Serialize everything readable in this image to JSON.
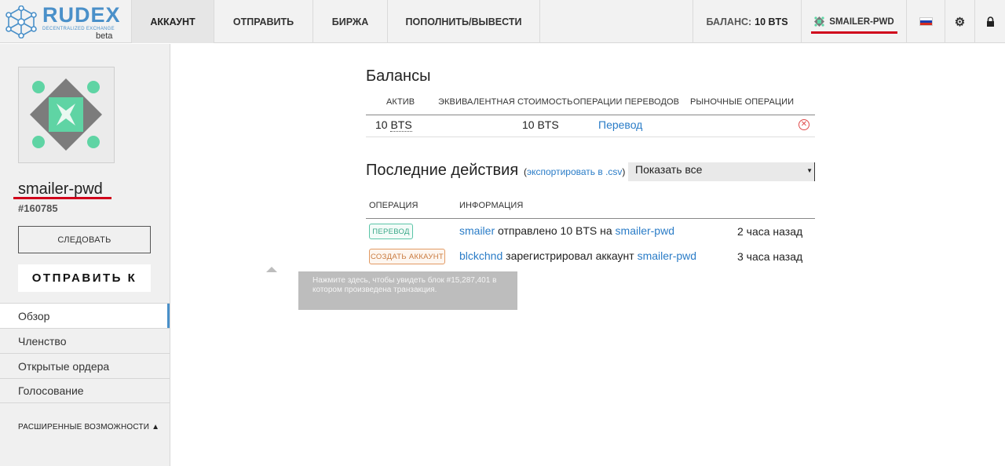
{
  "header": {
    "logo_name": "RUDEX",
    "logo_sub": "DECENTRALIZED EXCHANGE",
    "logo_beta": "beta",
    "nav": {
      "account": "АККАУНТ",
      "send": "ОТПРАВИТЬ",
      "exchange": "БИРЖА",
      "deposit": "ПОПОЛНИТЬ/ВЫВЕСТИ"
    },
    "balance_label": "БАЛАНС:",
    "balance_value": "10 BTS",
    "user_label": "SMAILER-PWD",
    "settings_icon": "⚙",
    "lock_icon": "lock"
  },
  "sidebar": {
    "account_name": "smailer-pwd",
    "account_id": "#160785",
    "follow_label": "СЛЕДОВАТЬ",
    "send_to_label": "ОТПРАВИТЬ К",
    "menu": [
      "Обзор",
      "Членство",
      "Открытые ордера",
      "Голосование"
    ],
    "advanced_label": "РАСШИРЕННЫЕ ВОЗМОЖНОСТИ ▲"
  },
  "balances": {
    "title": "Балансы",
    "headers": [
      "АКТИВ",
      "ЭКВИВАЛЕНТНАЯ СТОИМОСТЬ",
      "ОПЕРАЦИИ ПЕРЕВОДОВ",
      "РЫНОЧНЫЕ ОПЕРАЦИИ"
    ],
    "row": {
      "amount": "10",
      "asset": "BTS",
      "value": "10 BTS",
      "transfer": "Перевод"
    }
  },
  "recent": {
    "title": "Последние действия",
    "export_open": "(",
    "export_link": "экспортировать в .csv",
    "export_close": ")",
    "filter_value": "Показать все",
    "headers": [
      "ОПЕРАЦИЯ",
      "ИНФОРМАЦИЯ"
    ],
    "rows": [
      {
        "badge": "ПЕРЕВОД",
        "from": "smailer",
        "text": "отправлено 10 BTS на",
        "to": "smailer-pwd",
        "time": "2 часа назад"
      },
      {
        "badge": "СОЗДАТЬ АККАУНТ",
        "from": "blckchnd",
        "text": "зарегистрировал аккаунт",
        "to": "smailer-pwd",
        "time": "3 часа назад"
      }
    ],
    "tooltip": "Нажмите здесь, чтобы увидеть блок #15,287,401 в котором произведена транзакция."
  },
  "colors": {
    "accent": "#4a90c9",
    "link": "#2a7cc7",
    "underline_red": "#d0021b",
    "badge_transfer": "#3aa888",
    "badge_create": "#c97a3e"
  }
}
